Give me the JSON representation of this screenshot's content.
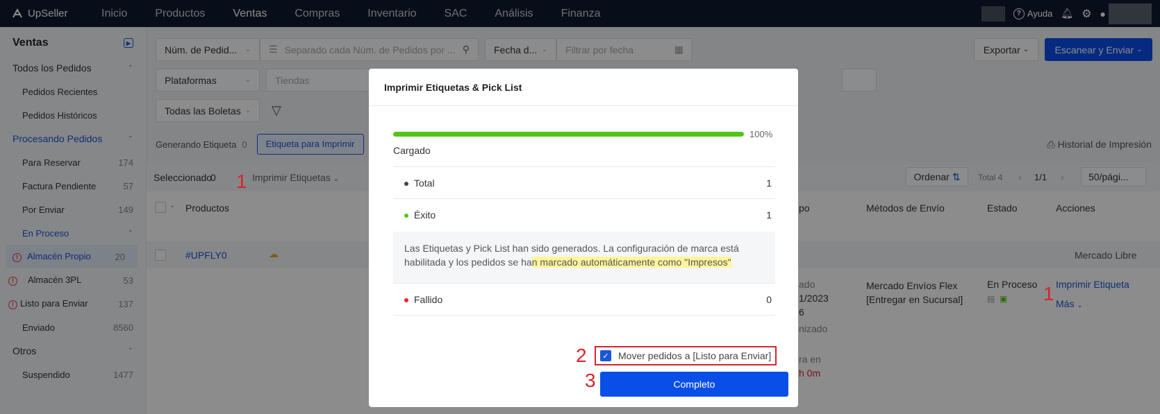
{
  "app": {
    "brand": "UpSeller"
  },
  "topnav": {
    "items": [
      "Inicio",
      "Productos",
      "Ventas",
      "Compras",
      "Inventario",
      "SAC",
      "Análisis",
      "Finanza"
    ],
    "help": "Ayuda"
  },
  "sidebar": {
    "title": "Ventas",
    "all_orders": "Todos los Pedidos",
    "recent": "Pedidos Recientes",
    "historic": "Pedidos Históricos",
    "processing": "Procesando Pedidos",
    "reserve": {
      "label": "Para Reservar",
      "count": "174"
    },
    "invoice": {
      "label": "Factura Pendiente",
      "count": "57"
    },
    "to_ship": {
      "label": "Por Enviar",
      "count": "149"
    },
    "in_process": "En Proceso",
    "own_wh": {
      "label": "Almacén Propio",
      "count": "20"
    },
    "wh3pl": {
      "label": "Almacén 3PL",
      "count": "53"
    },
    "ready": {
      "label": "Listo para Enviar",
      "count": "137"
    },
    "sent": {
      "label": "Enviado",
      "count": "8560"
    },
    "others": "Otros",
    "suspended": {
      "label": "Suspendido",
      "count": "1477"
    }
  },
  "filters": {
    "order_num": "Núm. de Pedid...",
    "search_placeholder": "Separado cada Núm. de Pedidos por ...",
    "date_select": "Fecha d...",
    "date_placeholder": "Filtrar por fecha",
    "platforms": "Plataformas",
    "stores": "Tiendas",
    "invoices": "Todas las Boletas",
    "export": "Exportar",
    "scan_ship": "Escanear y Enviar"
  },
  "tabs": {
    "generating": "Generando Etiqueta",
    "generating_count": "0",
    "to_print": "Etiqueta para Imprimir",
    "history": "Historial de Impresión"
  },
  "toolbar": {
    "selected": "Seleccionado",
    "selected_count": "0",
    "print_labels": "Imprimir Etiquetas",
    "sort": "Ordenar",
    "total": "Total 4",
    "page": "1/1",
    "per_page": "50/pági..."
  },
  "table": {
    "headers": {
      "products": "Productos",
      "time": "po",
      "shipping": "Métodos de Envío",
      "status": "Estado",
      "actions": "Acciones"
    },
    "order_id": "#UPFLY0",
    "marketplace": "Mercado Libre",
    "shipping_method": "Mercado Envíos Flex [Entregar en Sucursal]",
    "status": "En Proceso",
    "print_label": "Imprimir Etiqueta",
    "more": "Más",
    "partial": [
      "ado",
      "1/2023",
      "6",
      "nizado",
      "ra en",
      "h 0m"
    ]
  },
  "modal": {
    "title": "Imprimir Etiquetas & Pick List",
    "progress": 100,
    "progress_label": "100%",
    "loaded": "Cargado",
    "total_label": "Total",
    "total_value": "1",
    "success_label": "Éxito",
    "success_value": "1",
    "note_pre": "Las Etiquetas y Pick List han sido generados. La configuración de marca está habilitada y los pedidos se ha",
    "note_hl": "n marcado automáticamente como \"Impresos\"",
    "failed_label": "Fallido",
    "failed_value": "0",
    "move_checkbox": "Mover pedidos a [Listo para Enviar]",
    "complete": "Completo"
  },
  "annotations": [
    "1",
    "1",
    "2",
    "3",
    "1"
  ],
  "colors": {
    "nav_bg": "#0f1b2e",
    "primary": "#0a4ee8",
    "success": "#52c41a",
    "failed": "#f5222d",
    "annotation": "#d9232d"
  }
}
